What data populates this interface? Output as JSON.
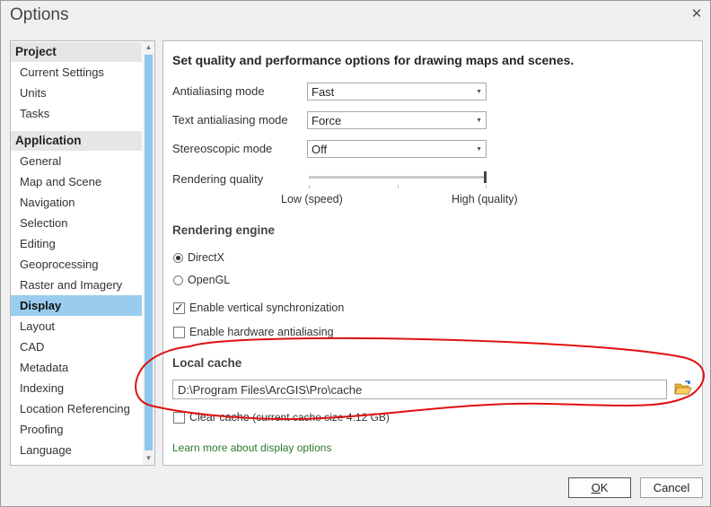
{
  "window": {
    "title": "Options",
    "close_glyph": "✕"
  },
  "nav": {
    "groups": [
      {
        "label": "Project",
        "items": [
          "Current Settings",
          "Units",
          "Tasks"
        ]
      },
      {
        "label": "Application",
        "items": [
          "General",
          "Map and Scene",
          "Navigation",
          "Selection",
          "Editing",
          "Geoprocessing",
          "Raster and Imagery",
          "Display",
          "Layout",
          "CAD",
          "Metadata",
          "Indexing",
          "Location Referencing",
          "Proofing",
          "Language"
        ]
      }
    ],
    "selected": "Display"
  },
  "display": {
    "heading": "Set quality and performance options for drawing maps and scenes.",
    "antialiasing": {
      "label": "Antialiasing mode",
      "value": "Fast"
    },
    "text_antialiasing": {
      "label": "Text antialiasing mode",
      "value": "Force"
    },
    "stereoscopic": {
      "label": "Stereoscopic mode",
      "value": "Off"
    },
    "rendering_quality": {
      "label": "Rendering quality",
      "low_label": "Low (speed)",
      "high_label": "High (quality)",
      "value_fraction": 1.0
    },
    "engine": {
      "title": "Rendering engine",
      "options": [
        {
          "label": "DirectX",
          "selected": true
        },
        {
          "label": "OpenGL",
          "selected": false
        }
      ]
    },
    "vsync": {
      "label": "Enable vertical synchronization",
      "checked": true
    },
    "hw_antialiasing": {
      "label": "Enable hardware antialiasing",
      "checked": false
    },
    "local_cache": {
      "title": "Local cache",
      "path": "D:\\Program Files\\ArcGIS\\Pro\\cache",
      "clear_label": "Clear cache",
      "cache_size_note": "(current cache size 4.12 GB)",
      "clear_checked": false
    },
    "learn_more_link": "Learn more about display options"
  },
  "buttons": {
    "ok_key": "O",
    "ok_rest": "K",
    "cancel": "Cancel"
  },
  "colors": {
    "selection": "#99ccee",
    "link": "#2a7a2a",
    "annotation": "#e01010"
  },
  "icons": {
    "close": "close-icon",
    "folder": "folder-open-icon",
    "combo_caret": "chevron-down-icon"
  }
}
